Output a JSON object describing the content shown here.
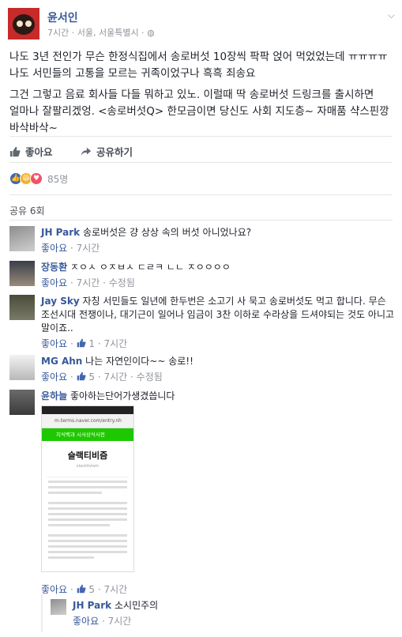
{
  "post": {
    "author": "윤서인",
    "meta": "7시간 · 서울, 서울특별시 ·",
    "para1": "나도 3년 전인가 무슨 한정식집에서 송로버섯 10장씩 팍팍 얹어 먹었었는데 ㅠㅠㅠㅠ 나도 서민들의 고통을 모르는 귀족이었구나 흑흑 죄송요",
    "para2": "그건 그렇고 음료 회사들 다들 뭐하고 있노. 이럴때 딱 송로버섯 드링크를 출시하면 얼마나 잘팔리겠엉. <송로버섯Q> 한모금이면 당신도 사회 지도층~ 자매품 샥스핀깡 바삭바삭~"
  },
  "actions": {
    "like": "좋아요",
    "share": "공유하기"
  },
  "reactions": {
    "count": "85명"
  },
  "shares": "공유 6회",
  "comments": [
    {
      "name": "JH Park",
      "text": "송로버섯은 걍 상상 속의 버섯 아니었나요?",
      "like": "좋아요",
      "time": "7시간"
    },
    {
      "name": "장동환",
      "text": "ㅈㅇㅅ ㅇㅈㅂㅅ ㄷㄹㅋ ㄴㄴ ㅈㅇㅇㅇㅇ",
      "like": "좋아요",
      "time": "7시간",
      "edited": "수정됨"
    },
    {
      "name": "Jay Sky",
      "text": "자칭 서민들도 일년에 한두번은 소고기 사 묵고 송로버섯도 먹고 합니다. 무슨 조선시대 전쟁이나, 대기근이 일어나 임금이 3찬 이하로 수라상을 드셔야되는 것도 아니고 말이죠..",
      "like": "좋아요",
      "likes": "1",
      "time": "7시간"
    },
    {
      "name": "MG Ahn",
      "text": "나는 자연인이다~~ 송로!!",
      "like": "좋아요",
      "likes": "5",
      "time": "7시간",
      "edited": "수정됨"
    },
    {
      "name": "윤하늘",
      "text": "좋아하는단어가생겼씁니다",
      "like": "좋아요",
      "likes": "5",
      "time": "7시간"
    }
  ],
  "reply": {
    "name": "JH Park",
    "text": "소시민주의",
    "like": "좋아요",
    "time": "7시간"
  },
  "screenshot": {
    "url": "m.terms.naver.com/entry.nh",
    "bar": "지식백과 시사상식사전",
    "title": "슬랙티비즘",
    "subtitle": "slacktivism"
  },
  "colors": {
    "link": "#365899",
    "muted": "#90949c",
    "like": "#4267b2",
    "haha": "#f7b125",
    "love": "#f25268"
  }
}
